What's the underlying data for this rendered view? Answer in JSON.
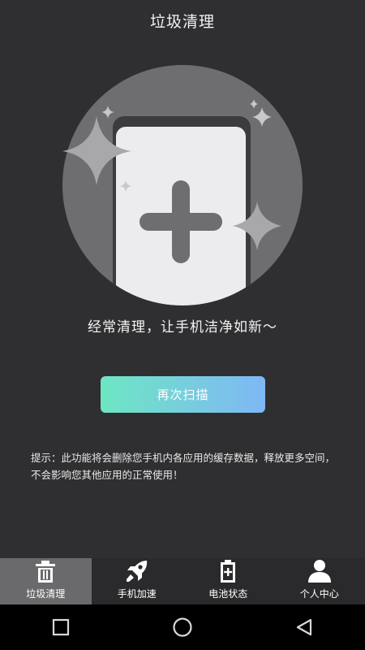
{
  "header": {
    "title": "垃圾清理"
  },
  "main": {
    "tagline": "经常清理，让手机洁净如新～",
    "scan_button": "再次扫描",
    "hint_line1": "提示：此功能将会删除您手机内各应用的缓存数据，释放更多空间，",
    "hint_line2": "不会影响您其他应用的正常使用！"
  },
  "tabs": [
    {
      "label": "垃圾清理",
      "icon": "trash-icon",
      "active": true
    },
    {
      "label": "手机加速",
      "icon": "rocket-icon",
      "active": false
    },
    {
      "label": "电池状态",
      "icon": "battery-icon",
      "active": false
    },
    {
      "label": "个人中心",
      "icon": "person-icon",
      "active": false
    }
  ],
  "navbar": {
    "buttons": [
      "recent-apps-icon",
      "home-icon",
      "back-icon"
    ]
  },
  "colors": {
    "background": "#2f2f31",
    "button_gradient_start": "#6ee6c3",
    "button_gradient_end": "#7fb7f6",
    "active_tab": "#6a6a6c"
  }
}
